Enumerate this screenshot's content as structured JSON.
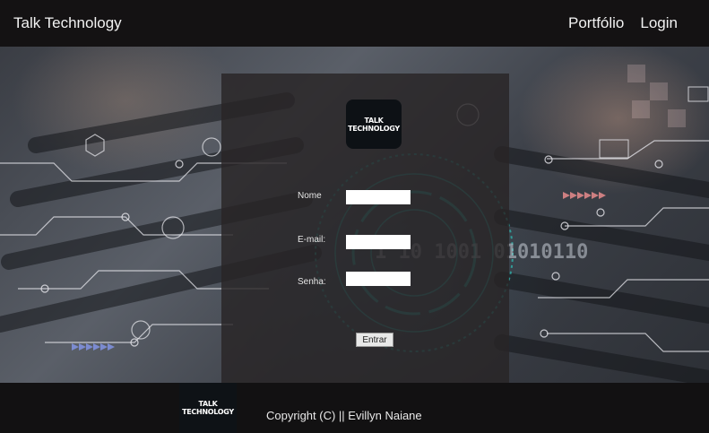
{
  "header": {
    "brand": "Talk Technology",
    "nav": {
      "portfolio": "Portfólio",
      "login": "Login"
    }
  },
  "hero": {
    "binary_text": "1 10  1001  01010110",
    "icon_names": [
      "keyboard-photo",
      "bitcoin-icon",
      "user-icon",
      "cart-icon",
      "mail-icon",
      "share-icon"
    ]
  },
  "card": {
    "logo_lines": [
      "TALK",
      "TECHNOLOGY"
    ],
    "fields": {
      "name_label": "Nome",
      "email_label": "E-mail:",
      "password_label": "Senha:"
    },
    "submit_label": "Entrar"
  },
  "footer": {
    "logo_lines": [
      "TALK",
      "TECHNOLOGY"
    ],
    "copyright": "Copyright (C) || Evillyn Naiane"
  },
  "colors": {
    "header_bg": "#141213",
    "card_bg": "rgba(40,36,38,0.82)",
    "accent_teal": "#2fb8b0",
    "footer_bg": "#121112"
  }
}
